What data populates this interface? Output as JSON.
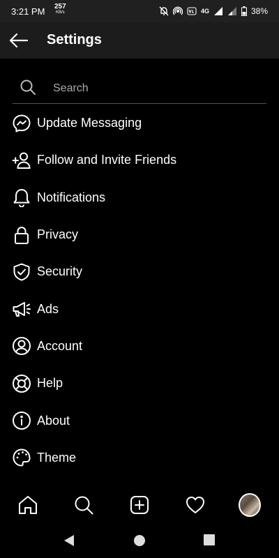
{
  "status_bar": {
    "time": "3:21 PM",
    "speed_value": "257",
    "speed_unit": "KB/s",
    "network": "4G",
    "battery": "38%"
  },
  "header": {
    "title": "Settings",
    "back_icon": "arrow-left-icon"
  },
  "search": {
    "placeholder": "Search",
    "value": ""
  },
  "menu": {
    "items": [
      {
        "label": "Update Messaging",
        "icon": "messenger-icon"
      },
      {
        "label": "Follow and Invite Friends",
        "icon": "add-person-icon"
      },
      {
        "label": "Notifications",
        "icon": "bell-icon"
      },
      {
        "label": "Privacy",
        "icon": "lock-icon"
      },
      {
        "label": "Security",
        "icon": "shield-check-icon"
      },
      {
        "label": "Ads",
        "icon": "megaphone-icon"
      },
      {
        "label": "Account",
        "icon": "user-circle-icon"
      },
      {
        "label": "Help",
        "icon": "lifebuoy-icon"
      },
      {
        "label": "About",
        "icon": "info-icon"
      },
      {
        "label": "Theme",
        "icon": "palette-icon"
      }
    ]
  },
  "bottom_nav": {
    "items": [
      "home-icon",
      "search-icon",
      "new-post-icon",
      "heart-icon",
      "profile-avatar"
    ]
  },
  "colors": {
    "background": "#000000",
    "header": "#1c1c1c",
    "status_bar": "#202020",
    "text": "#ffffff",
    "divider": "#555555"
  }
}
